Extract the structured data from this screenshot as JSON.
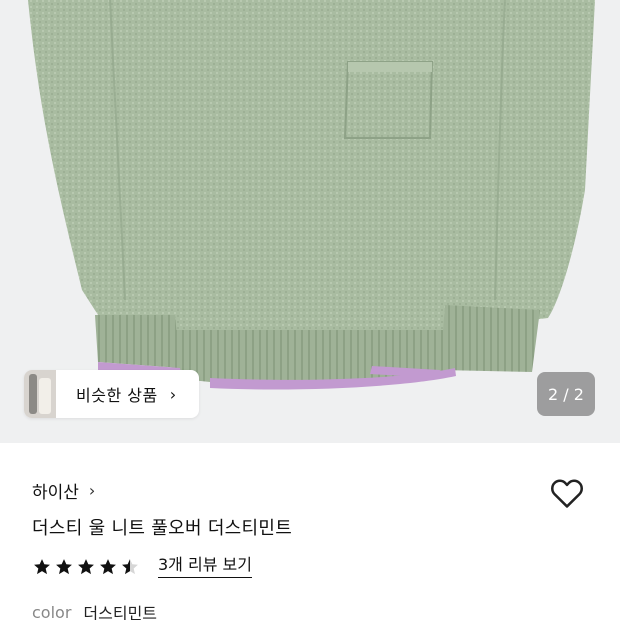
{
  "gallery": {
    "similar_products_label": "비슷한 상품",
    "page_counter": "2 / 2",
    "image_description_colors": {
      "knit": "#a9bca1",
      "trim": "#c29ad0",
      "background": "#eff0f1"
    }
  },
  "product": {
    "brand": "하이산",
    "title": "더스티 울 니트 풀오버 더스티민트",
    "rating": 4.5,
    "review_link": "3개 리뷰 보기",
    "option_label": "color",
    "option_value": "더스티민트"
  },
  "icons": {
    "chevron": "chevron-right-icon",
    "like": "heart-outline-icon",
    "star": "star-icon"
  }
}
